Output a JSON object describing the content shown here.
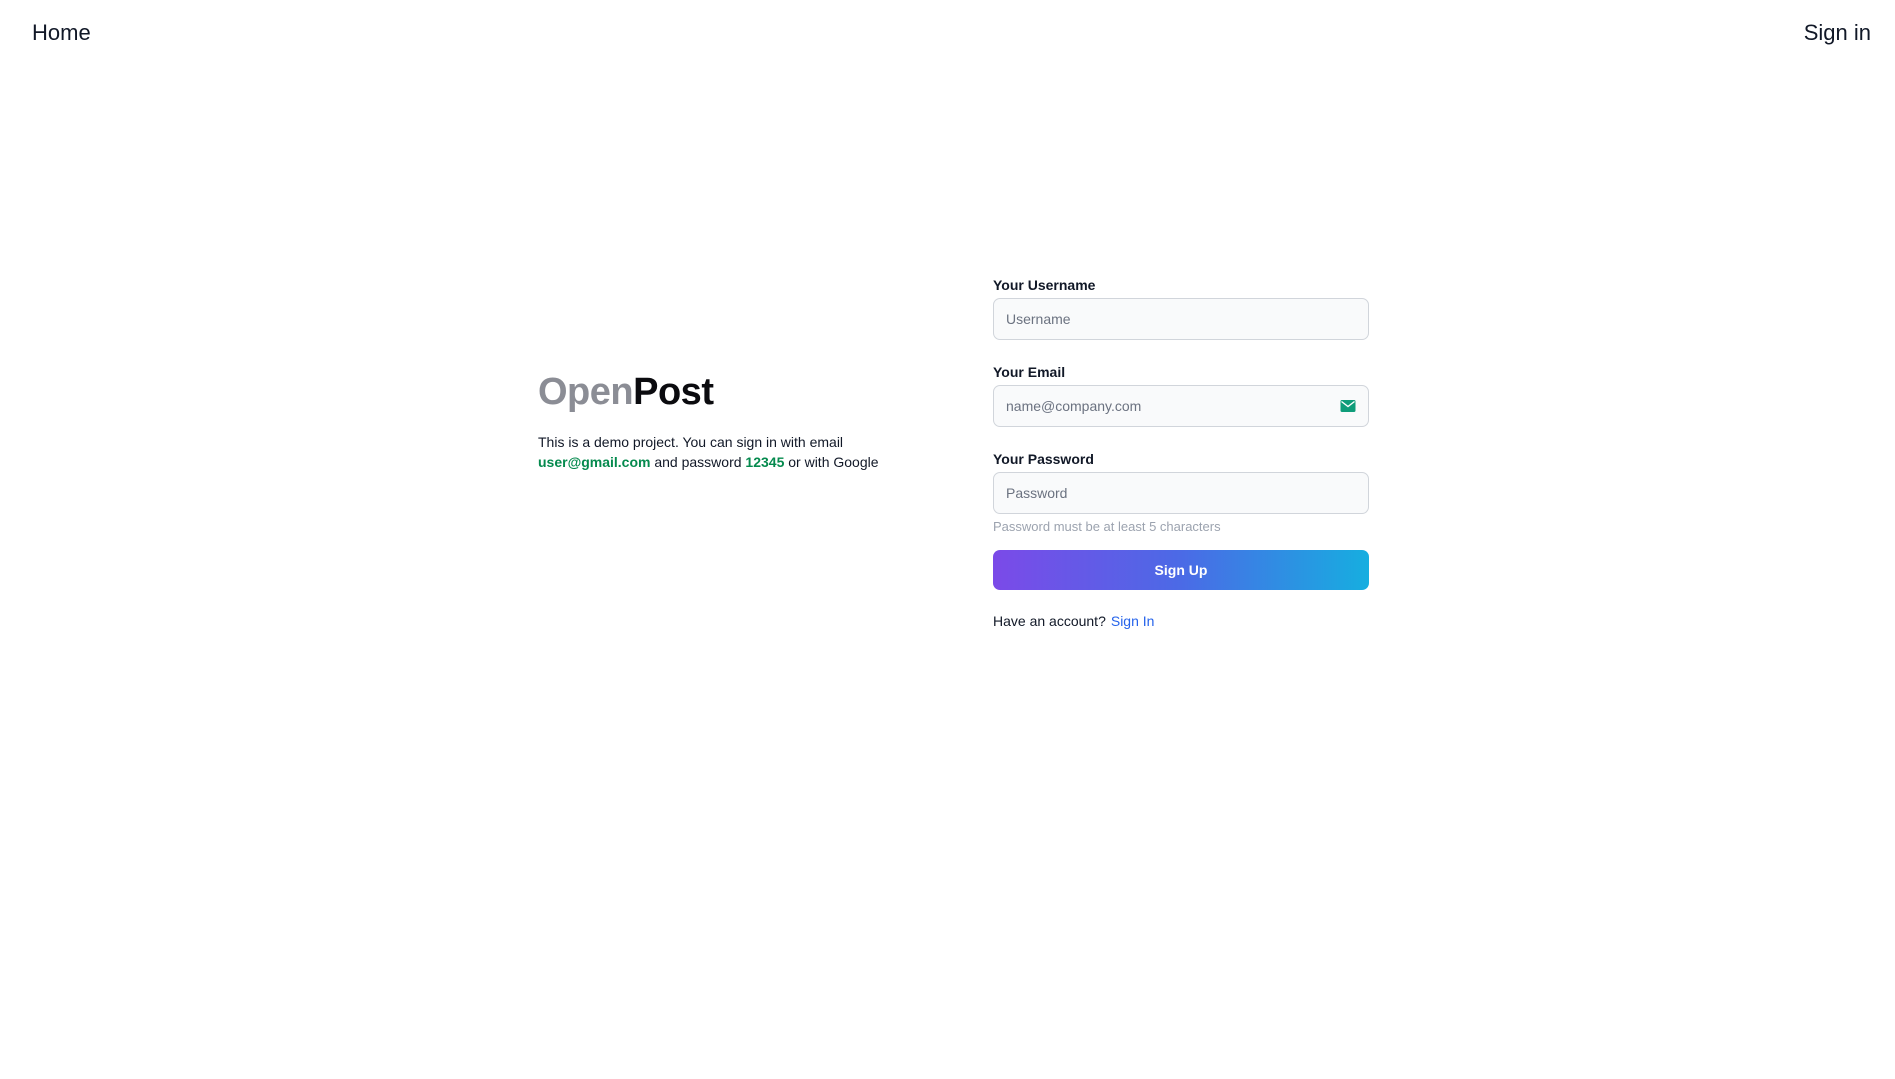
{
  "nav": {
    "home_label": "Home",
    "signin_label": "Sign in"
  },
  "brand": {
    "open": "Open",
    "post": "Post"
  },
  "intro": {
    "line1": "This is a demo project. You can sign in with email",
    "email": "user@gmail.com",
    "mid": " and password ",
    "password": "12345",
    "end": " or with Google"
  },
  "form": {
    "username_label": "Your Username",
    "username_placeholder": "Username",
    "username_value": "",
    "email_label": "Your Email",
    "email_placeholder": "name@company.com",
    "email_value": "",
    "password_label": "Your Password",
    "password_placeholder": "Password",
    "password_value": "",
    "password_hint": "Password must be at least 5 characters",
    "submit_label": "Sign Up",
    "account_prompt": "Have an account?",
    "signin_link": "Sign In"
  },
  "icons": {
    "email_field_icon": "envelope-icon"
  },
  "colors": {
    "brand_open": "#8b8d95",
    "brand_post": "#0b0b0f",
    "highlight_green": "#058a4e",
    "link_blue": "#2563eb",
    "button_gradient_start": "#7b4ae8",
    "button_gradient_end": "#16aee0",
    "icon_teal": "#0f9d7a"
  }
}
